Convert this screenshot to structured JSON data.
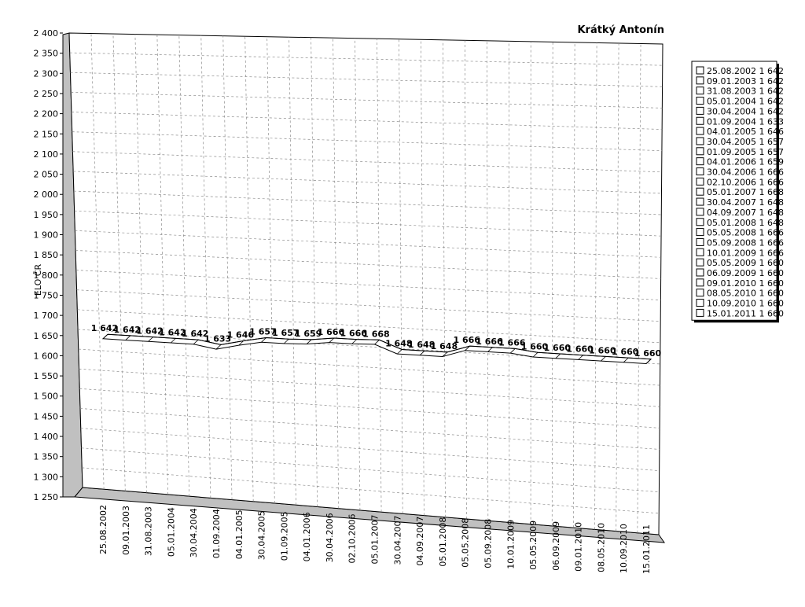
{
  "chart_data": {
    "type": "line",
    "title": "Krátký Antonín",
    "ylabel": "ELO ČR",
    "xlabel": "",
    "ylim": [
      1250,
      2400
    ],
    "ystep": 50,
    "grid": true,
    "legend_position": "right",
    "y_tick_labels": [
      "1 250",
      "1 300",
      "1 350",
      "1 400",
      "1 450",
      "1 500",
      "1 550",
      "1 600",
      "1 650",
      "1 700",
      "1 750",
      "1 800",
      "1 850",
      "1 900",
      "1 950",
      "2 000",
      "2 050",
      "2 100",
      "2 150",
      "2 200",
      "2 250",
      "2 300",
      "2 350",
      "2 400"
    ],
    "categories": [
      "25.08.2002",
      "09.01.2003",
      "31.08.2003",
      "05.01.2004",
      "30.04.2004",
      "01.09.2004",
      "04.01.2005",
      "30.04.2005",
      "01.09.2005",
      "04.01.2006",
      "30.04.2006",
      "02.10.2006",
      "05.01.2007",
      "30.04.2007",
      "04.09.2007",
      "05.01.2008",
      "05.05.2008",
      "05.09.2008",
      "10.01.2009",
      "05.05.2009",
      "06.09.2009",
      "09.01.2010",
      "08.05.2010",
      "10.09.2010",
      "15.01.2011"
    ],
    "values": [
      1642,
      1642,
      1642,
      1642,
      1642,
      1633,
      1646,
      1657,
      1657,
      1659,
      1666,
      1666,
      1668,
      1648,
      1648,
      1648,
      1666,
      1666,
      1666,
      1660,
      1660,
      1660,
      1660,
      1660,
      1660
    ],
    "value_labels": [
      "1 642",
      "1 642",
      "1 642",
      "1 642",
      "1 642",
      "1 633",
      "1 646",
      "1 657",
      "1 657",
      "1 659",
      "1 666",
      "1 666",
      "1 668",
      "1 648",
      "1 648",
      "1 648",
      "1 666",
      "1 666",
      "1 666",
      "1 660",
      "1 660",
      "1 660",
      "1 660",
      "1 660",
      "1 660"
    ],
    "legend": [
      "25.08.2002 1 642",
      "09.01.2003 1 642",
      "31.08.2003 1 642",
      "05.01.2004 1 642",
      "30.04.2004 1 642",
      "01.09.2004 1 633",
      "04.01.2005 1 646",
      "30.04.2005 1 657",
      "01.09.2005 1 657",
      "04.01.2006 1 659",
      "30.04.2006 1 666",
      "02.10.2006 1 666",
      "05.01.2007 1 668",
      "30.04.2007 1 648",
      "04.09.2007 1 648",
      "05.01.2008 1 648",
      "05.05.2008 1 666",
      "05.09.2008 1 666",
      "10.01.2009 1 666",
      "05.05.2009 1 660",
      "06.09.2009 1 660",
      "09.01.2010 1 660",
      "08.05.2010 1 660",
      "10.09.2010 1 660",
      "15.01.2011 1 660"
    ],
    "colors": {
      "line": "#000000",
      "ribbon": "#ffffff",
      "grid": "#8c8c8c",
      "wall": "#c0c0c0"
    }
  }
}
